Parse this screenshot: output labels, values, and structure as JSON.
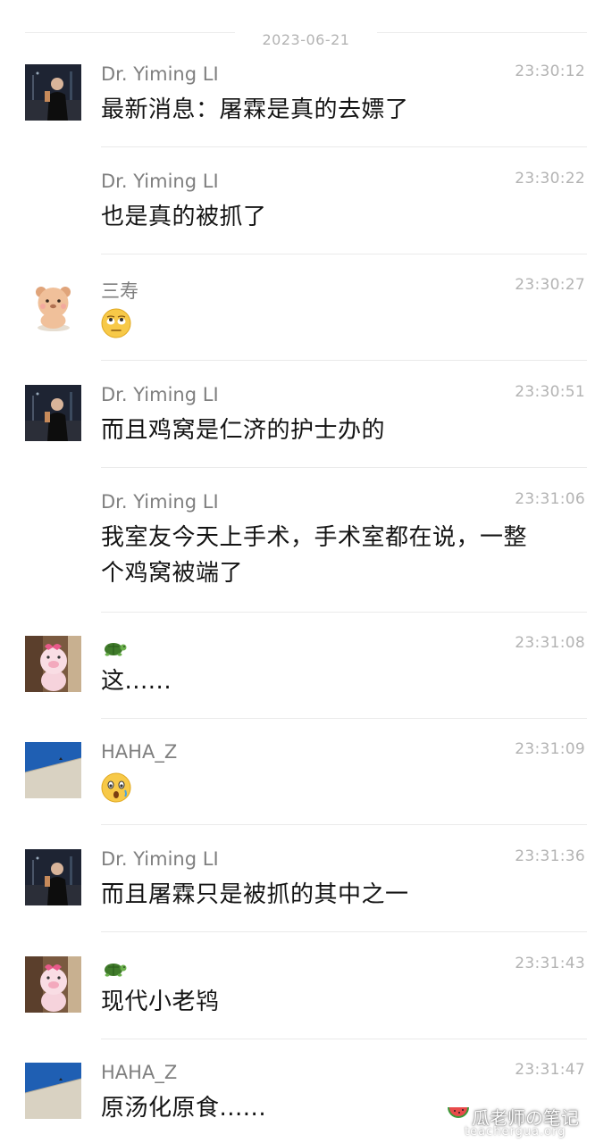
{
  "date_divider": "2023-06-21",
  "messages": [
    {
      "sender": "Dr. Yiming LI",
      "time": "23:30:12",
      "text": "最新消息：屠霖是真的去嫖了",
      "avatar": "dr-yiming-avatar"
    },
    {
      "sender": "Dr. Yiming LI",
      "time": "23:30:22",
      "text": "也是真的被抓了"
    },
    {
      "sender": "三寿",
      "time": "23:30:27",
      "emoji": "rolling-eyes-emoji",
      "avatar": "bear-avatar"
    },
    {
      "sender": "Dr. Yiming LI",
      "time": "23:30:51",
      "text": "而且鸡窝是仁济的护士办的",
      "avatar": "dr-yiming-avatar"
    },
    {
      "sender": "Dr. Yiming LI",
      "time": "23:31:06",
      "text_lines": [
        "我室友今天上手术，手术室都在说，一整",
        "个鸡窝被端了"
      ]
    },
    {
      "sender_icon": "turtle-icon",
      "time": "23:31:08",
      "text": "这......",
      "avatar": "pink-pig-avatar"
    },
    {
      "sender": "HAHA_Z",
      "time": "23:31:09",
      "emoji": "surprised-emoji",
      "avatar": "sky-wall-avatar"
    },
    {
      "sender": "Dr. Yiming LI",
      "time": "23:31:36",
      "text": "而且屠霖只是被抓的其中之一",
      "avatar": "dr-yiming-avatar"
    },
    {
      "sender_icon": "turtle-icon",
      "time": "23:31:43",
      "text": "现代小老鸨",
      "avatar": "pink-pig-avatar"
    },
    {
      "sender": "HAHA_Z",
      "time": "23:31:47",
      "text": "原汤化原食......",
      "avatar": "sky-wall-avatar"
    }
  ],
  "watermark": {
    "title": "瓜老师の笔记",
    "url": "teachergua.org"
  }
}
